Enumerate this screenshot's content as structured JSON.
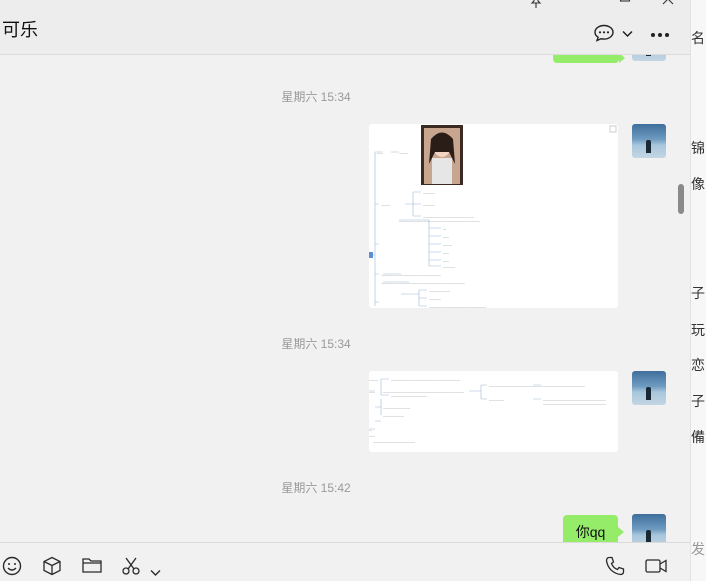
{
  "window": {
    "title": "可乐"
  },
  "header": {
    "chat_icon": "chat-bubble-icon",
    "more_icon": "more-icon"
  },
  "messages": {
    "ts1": "星期六 15:34",
    "ts2": "星期六 15:34",
    "ts3": "星期六 15:42",
    "last_text": "你qq"
  },
  "right_panel": {
    "lines": [
      "名",
      "锦",
      "像",
      "子",
      "玩",
      "恋",
      "子",
      "備,",
      "发"
    ]
  },
  "colors": {
    "bubble": "#95ec69",
    "chat_bg": "#f1f1f1"
  }
}
